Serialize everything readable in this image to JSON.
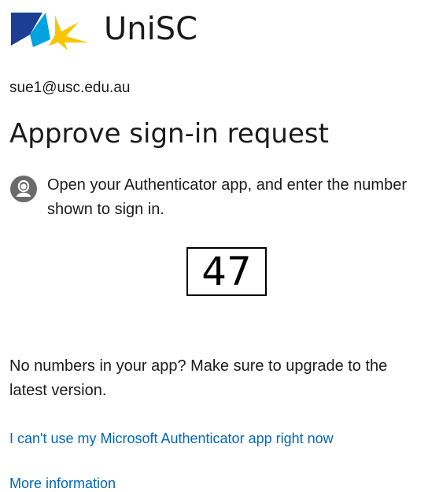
{
  "brand": {
    "name": "UniSC",
    "colors": {
      "navy": "#1c3f94",
      "light_blue": "#00a3e0",
      "yellow": "#f7c600"
    }
  },
  "identity": {
    "email": "sue1@usc.edu.au"
  },
  "main": {
    "title": "Approve sign-in request",
    "instruction_icon": "lock-person-icon",
    "instruction": "Open your Authenticator app, and enter the number shown to sign in.",
    "number": "47",
    "upgrade_note": "No numbers in your app? Make sure to upgrade to the latest version."
  },
  "links": {
    "cant_use_app": "I can't use my Microsoft Authenticator app right now",
    "more_info": "More information"
  },
  "colors": {
    "link": "#0067b8",
    "text": "#1b1b1b",
    "icon": "#6b6b6b"
  }
}
